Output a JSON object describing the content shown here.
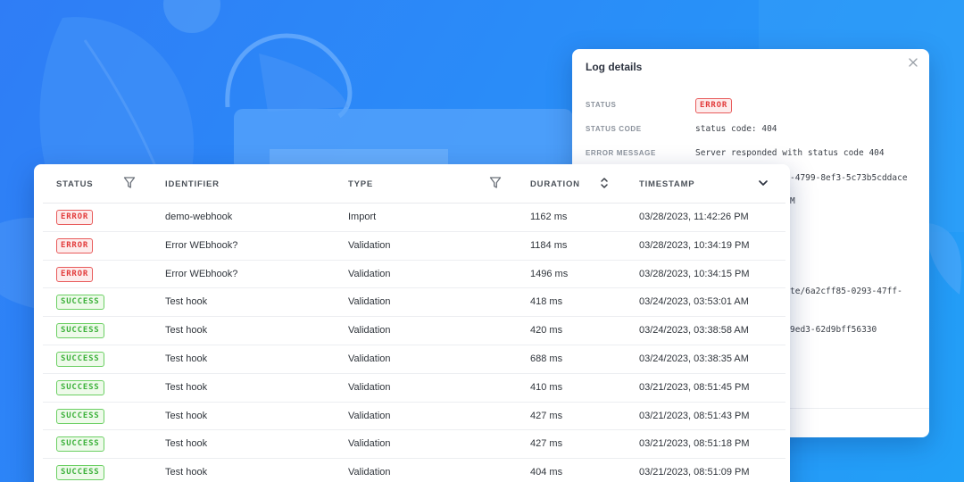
{
  "details": {
    "title": "Log details",
    "close_icon": "close-icon",
    "fields": [
      {
        "label": "STATUS",
        "value": "ERROR",
        "kind": "badge-error"
      },
      {
        "label": "STATUS CODE",
        "value": "status code: 404"
      },
      {
        "label": "ERROR MESSAGE",
        "value": "Server responded with status code 404"
      }
    ],
    "fragments": [
      "-4799-8ef3-5c73b5cddace",
      "M",
      "te/6a2cff85-0293-47ff-",
      "9ed3-62d9bff56330"
    ]
  },
  "table": {
    "columns": {
      "status": "STATUS",
      "identifier": "IDENTIFIER",
      "type": "TYPE",
      "duration": "DURATION",
      "timestamp": "TIMESTAMP"
    },
    "icons": {
      "status_filter": "filter-icon",
      "type_filter": "filter-icon",
      "duration_sort": "sort-icon",
      "timestamp_sort": "chevron-down-icon"
    },
    "rows": [
      {
        "status": "ERROR",
        "identifier": "demo-webhook",
        "type": "Import",
        "duration": "1162 ms",
        "timestamp": "03/28/2023, 11:42:26 PM"
      },
      {
        "status": "ERROR",
        "identifier": "Error WEbhook?",
        "type": "Validation",
        "duration": "1184 ms",
        "timestamp": "03/28/2023, 10:34:19 PM"
      },
      {
        "status": "ERROR",
        "identifier": "Error WEbhook?",
        "type": "Validation",
        "duration": "1496 ms",
        "timestamp": "03/28/2023, 10:34:15 PM"
      },
      {
        "status": "SUCCESS",
        "identifier": "Test hook",
        "type": "Validation",
        "duration": "418 ms",
        "timestamp": "03/24/2023, 03:53:01 AM"
      },
      {
        "status": "SUCCESS",
        "identifier": "Test hook",
        "type": "Validation",
        "duration": "420 ms",
        "timestamp": "03/24/2023, 03:38:58 AM"
      },
      {
        "status": "SUCCESS",
        "identifier": "Test hook",
        "type": "Validation",
        "duration": "688 ms",
        "timestamp": "03/24/2023, 03:38:35 AM"
      },
      {
        "status": "SUCCESS",
        "identifier": "Test hook",
        "type": "Validation",
        "duration": "410 ms",
        "timestamp": "03/21/2023, 08:51:45 PM"
      },
      {
        "status": "SUCCESS",
        "identifier": "Test hook",
        "type": "Validation",
        "duration": "427 ms",
        "timestamp": "03/21/2023, 08:51:43 PM"
      },
      {
        "status": "SUCCESS",
        "identifier": "Test hook",
        "type": "Validation",
        "duration": "427 ms",
        "timestamp": "03/21/2023, 08:51:18 PM"
      },
      {
        "status": "SUCCESS",
        "identifier": "Test hook",
        "type": "Validation",
        "duration": "404 ms",
        "timestamp": "03/21/2023, 08:51:09 PM"
      }
    ]
  },
  "colors": {
    "background": "#2a8cf8",
    "error": "#e23b3b",
    "success": "#3cb13a"
  }
}
